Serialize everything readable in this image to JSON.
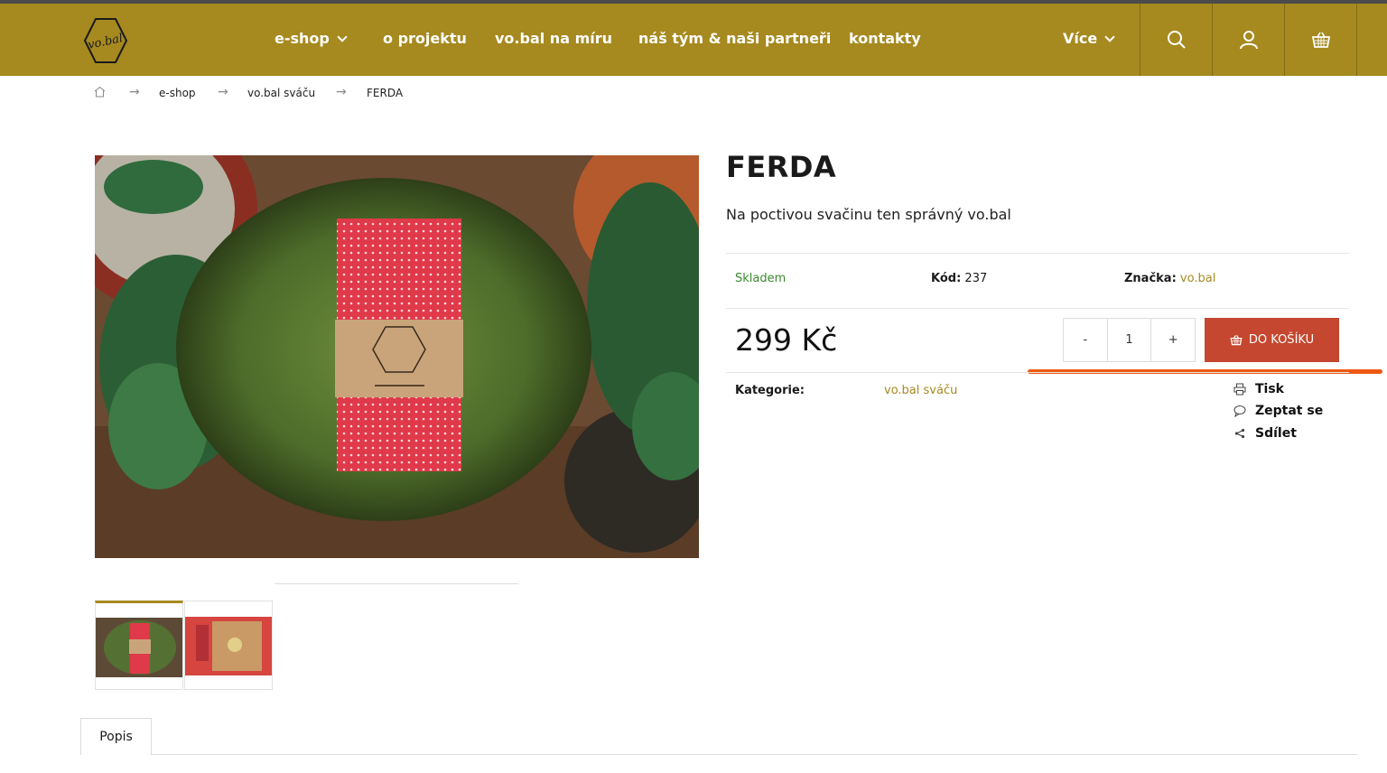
{
  "nav": {
    "items": [
      {
        "label": "e-shop"
      },
      {
        "label": "o projektu"
      },
      {
        "label": "vo.bal na míru"
      },
      {
        "label": "náš tým & naši partneři"
      },
      {
        "label": "kontakty"
      }
    ],
    "more_label": "Více",
    "icons": [
      "search-icon",
      "user-icon",
      "basket-icon"
    ]
  },
  "logo": {
    "text": "vo.bal"
  },
  "breadcrumb": [
    "e-shop",
    "vo.bal sváču",
    "FERDA"
  ],
  "product": {
    "title": "FERDA",
    "description": "Na poctivou svačinu ten správný vo.bal",
    "availability": "Skladem",
    "code_label": "Kód:",
    "code_value": "237",
    "brand_label": "Značka:",
    "brand_value": "vo.bal",
    "price": "299 Kč",
    "quantity": "1",
    "qty_minus": "-",
    "qty_plus": "+",
    "add_to_cart": "DO KOŠÍKU",
    "category_label": "Kategorie:",
    "category_value": "vo.bal sváču"
  },
  "actions": [
    {
      "label": "Tisk",
      "icon": "printer-icon"
    },
    {
      "label": "Zeptat se",
      "icon": "chat-bubble-icon"
    },
    {
      "label": "Sdílet",
      "icon": "share-icon"
    }
  ],
  "tabs": [
    {
      "label": "Popis"
    }
  ],
  "colors": {
    "header": "#a68a1f",
    "cart_button": "#c5472f",
    "in_stock": "#3a8a2e",
    "accent_link": "#a68a1f",
    "annotation": "#ee5a12"
  }
}
